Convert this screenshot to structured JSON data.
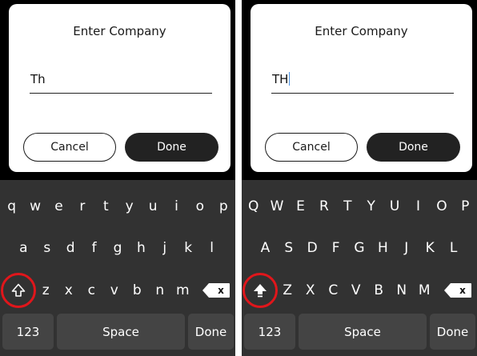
{
  "panels": [
    {
      "id": "lowercase",
      "dialog": {
        "title": "Enter Company",
        "field_value": "Th",
        "cancel_label": "Cancel",
        "done_label": "Done"
      },
      "keyboard": {
        "row1": [
          "q",
          "w",
          "e",
          "r",
          "t",
          "y",
          "u",
          "i",
          "o",
          "p"
        ],
        "row2": [
          "a",
          "s",
          "d",
          "f",
          "g",
          "h",
          "j",
          "k",
          "l"
        ],
        "row3": [
          "z",
          "x",
          "c",
          "v",
          "b",
          "n",
          "m"
        ],
        "shift_icon": "shift-outline-icon",
        "backspace_icon": "backspace-icon",
        "backspace_glyph": "x",
        "numbers_label": "123",
        "space_label": "Space",
        "done_label": "Done"
      }
    },
    {
      "id": "uppercase",
      "dialog": {
        "title": "Enter Company",
        "field_value": "TH",
        "cancel_label": "Cancel",
        "done_label": "Done"
      },
      "keyboard": {
        "row1": [
          "Q",
          "W",
          "E",
          "R",
          "T",
          "Y",
          "U",
          "I",
          "O",
          "P"
        ],
        "row2": [
          "A",
          "S",
          "D",
          "F",
          "G",
          "H",
          "J",
          "K",
          "L"
        ],
        "row3": [
          "Z",
          "X",
          "C",
          "V",
          "B",
          "N",
          "M"
        ],
        "shift_icon": "shift-filled-icon",
        "backspace_icon": "backspace-icon",
        "backspace_glyph": "x",
        "numbers_label": "123",
        "space_label": "Space",
        "done_label": "Done"
      }
    }
  ],
  "colors": {
    "screen_background": "#000000",
    "keyboard_background": "#323232",
    "wide_key_background": "#444444",
    "dialog_background": "#ffffff",
    "primary_button": "#222222",
    "caret": "#4a90e2",
    "highlight_ring": "#e0161b"
  }
}
